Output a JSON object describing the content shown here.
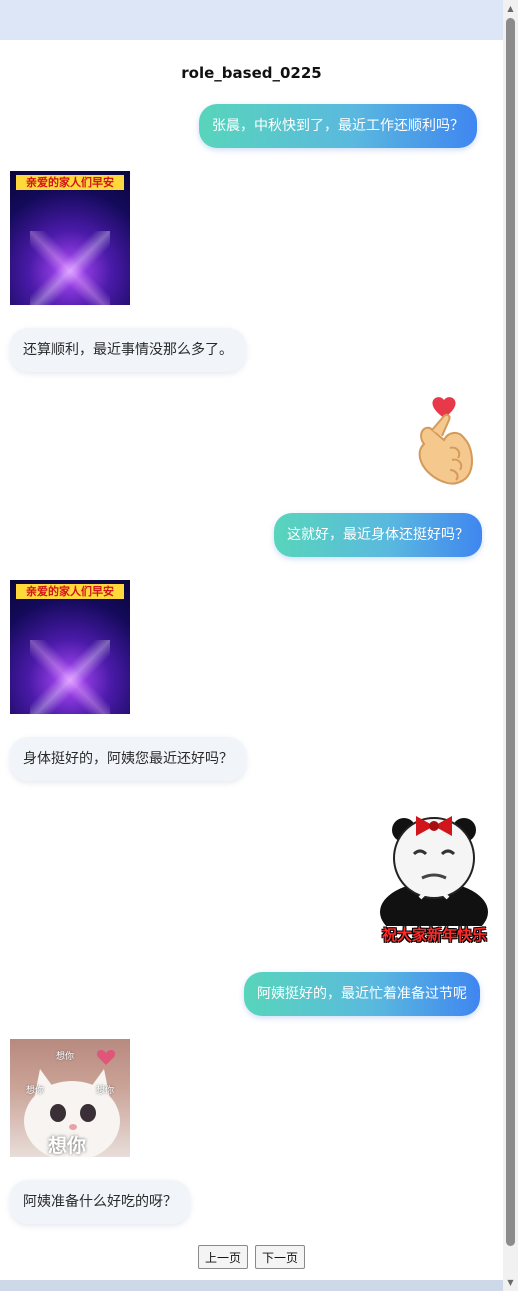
{
  "chat": {
    "title": "role_based_0225",
    "messages": [
      {
        "side": "right",
        "type": "text",
        "text": "张晨，中秋快到了，最近工作还顺利吗？"
      },
      {
        "side": "left",
        "type": "sticker",
        "sticker": "family-morning-greeting-card"
      },
      {
        "side": "left",
        "type": "text",
        "text": "还算顺利，最近事情没那么多了。"
      },
      {
        "side": "right",
        "type": "sticker",
        "sticker": "finger-heart-emoji"
      },
      {
        "side": "right",
        "type": "text",
        "text": "这就好，最近身体还挺好吗？"
      },
      {
        "side": "left",
        "type": "sticker",
        "sticker": "family-morning-greeting-card"
      },
      {
        "side": "left",
        "type": "text",
        "text": "身体挺好的，阿姨您最近还好吗？"
      },
      {
        "side": "right",
        "type": "sticker",
        "sticker": "panda-new-year-meme"
      },
      {
        "side": "right",
        "type": "text",
        "text": "阿姨挺好的，最近忙着准备过节呢"
      },
      {
        "side": "left",
        "type": "sticker",
        "sticker": "cat-miss-you"
      },
      {
        "side": "left",
        "type": "text",
        "text": "阿姨准备什么好吃的呀？"
      }
    ]
  },
  "stickers": {
    "greeting_card": {
      "title": "亲爱的家人们早安"
    },
    "panda": {
      "caption": "祝大家新年快乐"
    },
    "cat": {
      "small_left": "想你",
      "small_top": "想你",
      "small_right": "想你",
      "big": "想你"
    }
  },
  "pagination": {
    "prev_label": "上一页",
    "next_label": "下一页"
  },
  "colors": {
    "bubble_right_start": "#58d5bb",
    "bubble_right_end": "#3f86f0",
    "bubble_left_bg": "#f1f4f9",
    "page_bg": "#dce6f7"
  }
}
